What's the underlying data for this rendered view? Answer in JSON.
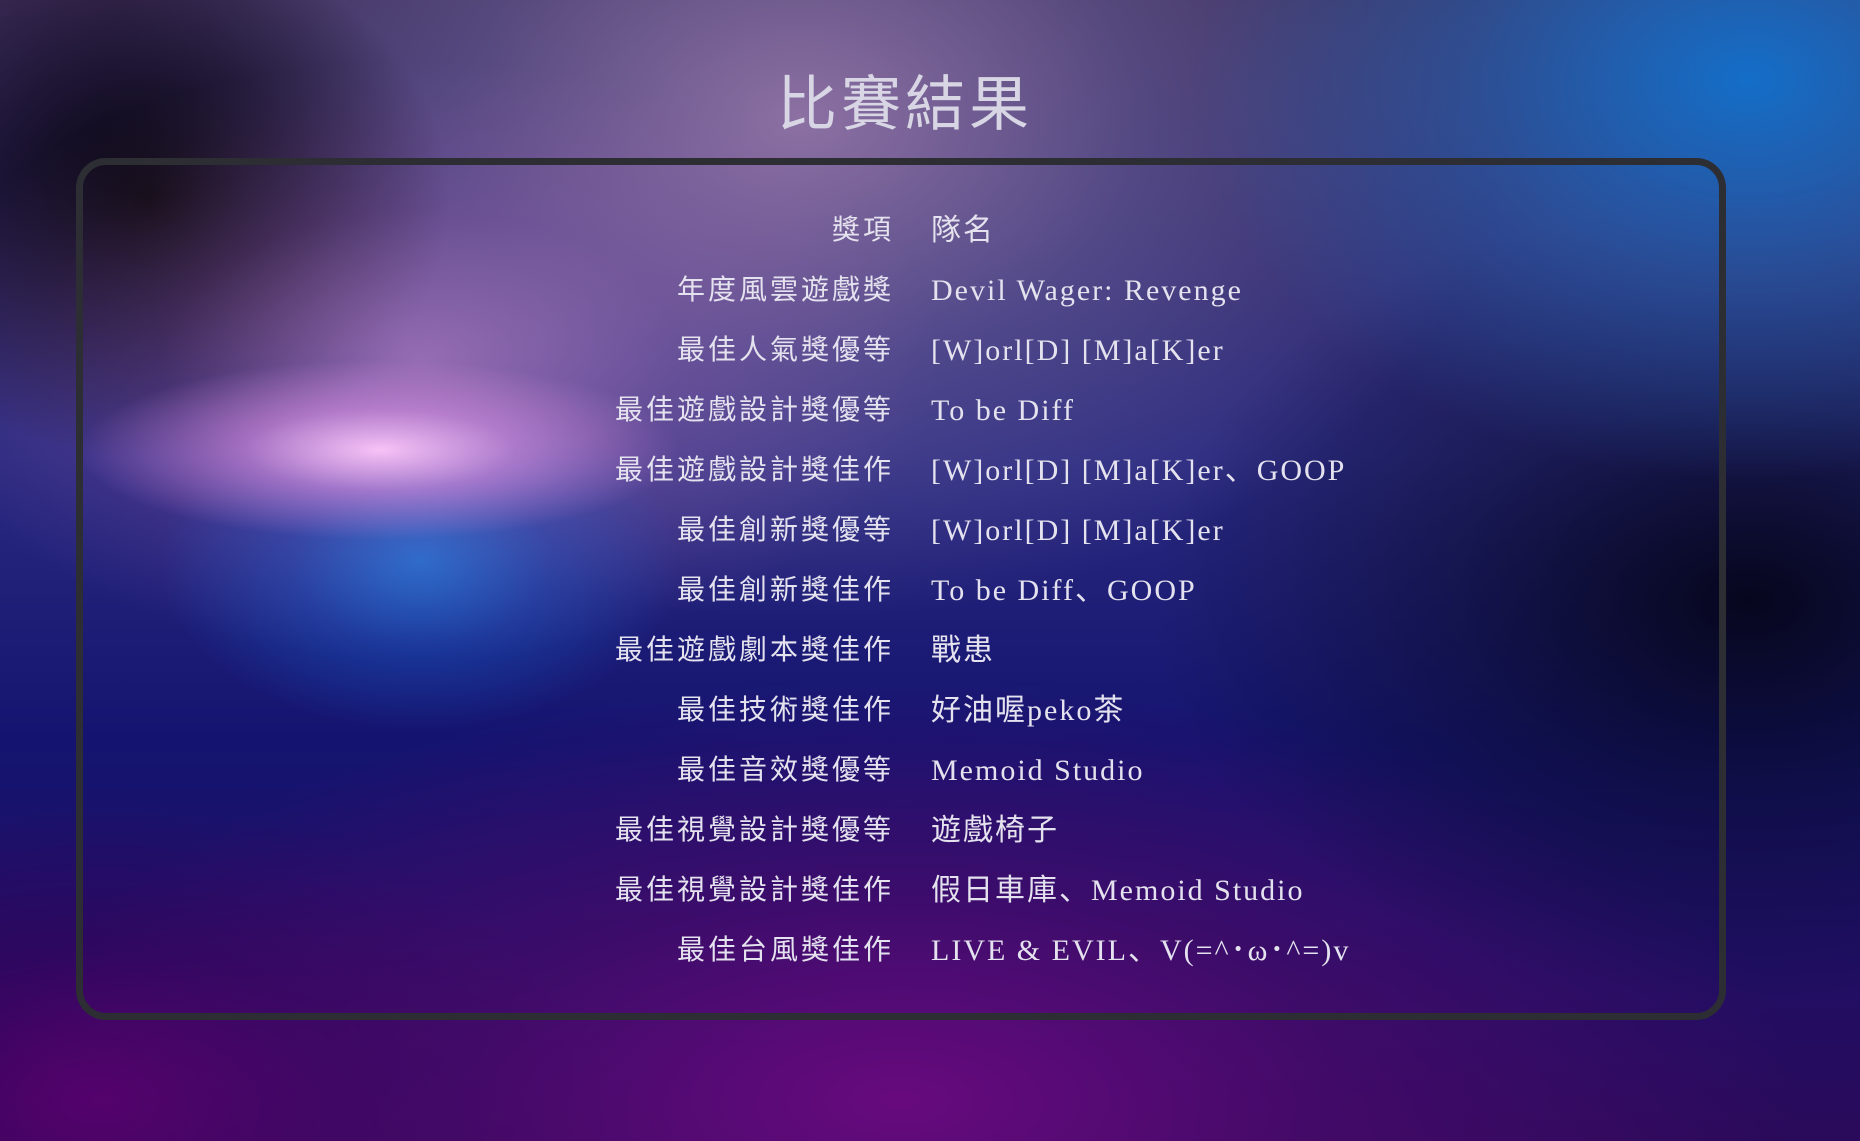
{
  "page": {
    "title": "比賽結果"
  },
  "table": {
    "header": {
      "award": "獎項",
      "team": "隊名"
    },
    "rows": [
      {
        "award": "年度風雲遊戲獎",
        "team": "Devil Wager: Revenge"
      },
      {
        "award": "最佳人氣獎優等",
        "team": "[W]orl[D] [M]a[K]er"
      },
      {
        "award": "最佳遊戲設計獎優等",
        "team": "To be Diff"
      },
      {
        "award": "最佳遊戲設計獎佳作",
        "team": "[W]orl[D] [M]a[K]er、GOOP"
      },
      {
        "award": "最佳創新獎優等",
        "team": "[W]orl[D] [M]a[K]er"
      },
      {
        "award": "最佳創新獎佳作",
        "team": "To be Diff、GOOP"
      },
      {
        "award": "最佳遊戲劇本獎佳作",
        "team": "戰患"
      },
      {
        "award": "最佳技術獎佳作",
        "team": "好油喔peko茶"
      },
      {
        "award": "最佳音效獎優等",
        "team": "Memoid Studio"
      },
      {
        "award": "最佳視覺設計獎優等",
        "team": "遊戲椅子"
      },
      {
        "award": "最佳視覺設計獎佳作",
        "team": "假日車庫、Memoid Studio"
      },
      {
        "award": "最佳台風獎佳作",
        "team": "LIVE & EVIL、V(=^･ω･^=)v"
      }
    ]
  },
  "colors": {
    "text": "#e4e2ee",
    "panel_border": "#2c2e34"
  }
}
